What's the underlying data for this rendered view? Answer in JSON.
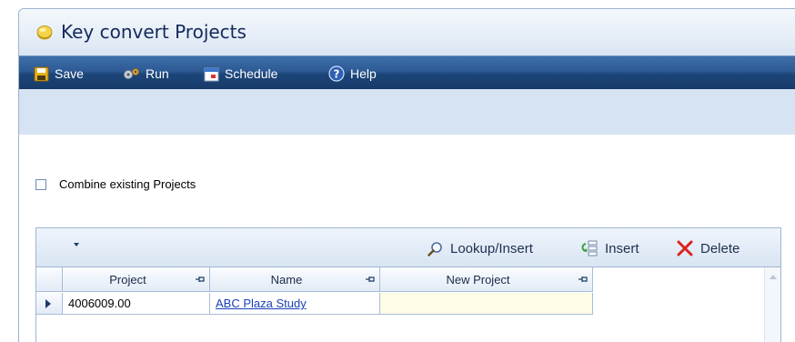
{
  "window": {
    "title": "Key convert Projects",
    "title_icon": "gold-coin-icon"
  },
  "toolbar": {
    "buttons": [
      {
        "label": "Save",
        "icon": "floppy-disk-icon"
      },
      {
        "label": "Run",
        "icon": "gears-icon"
      },
      {
        "label": "Schedule",
        "icon": "calendar-icon"
      },
      {
        "label": "Help",
        "icon": "question-circle-icon"
      }
    ]
  },
  "options": {
    "combine_label": "Combine existing Projects",
    "combine_checked": false
  },
  "grid": {
    "toolbar": {
      "lookup_label": "Lookup/Insert",
      "insert_label": "Insert",
      "delete_label": "Delete"
    },
    "columns": [
      "Project",
      "Name",
      "New Project"
    ],
    "rows": [
      {
        "project": "4006009.00",
        "name": "ABC Plaza Study",
        "new_project": ""
      }
    ]
  },
  "colors": {
    "toolbar_bg": "#1c4578",
    "subbar_bg": "#d6e3f3",
    "new_project_cell": "#fefbe6",
    "link": "#1a3fb8"
  }
}
